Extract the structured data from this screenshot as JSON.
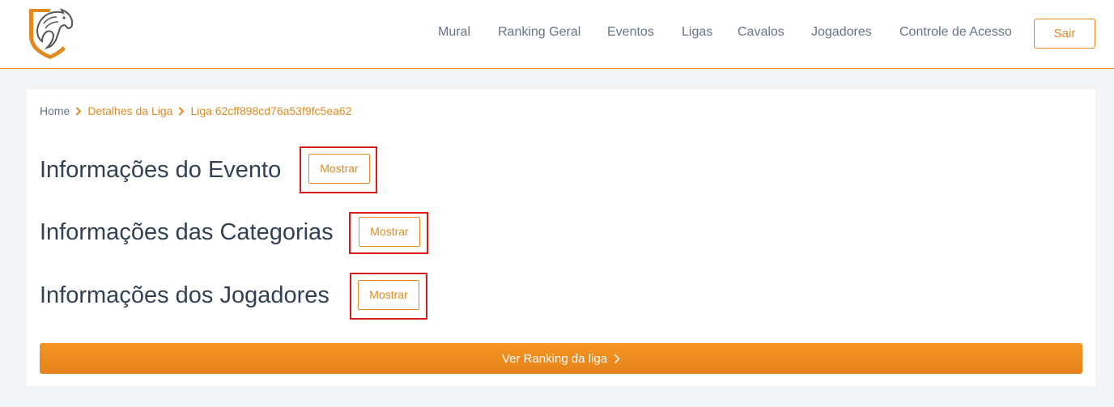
{
  "brand": {
    "logo_icon": "horse-shield-logo",
    "accent_color": "#e08a1f"
  },
  "nav": {
    "items": [
      "Mural",
      "Ranking Geral",
      "Eventos",
      "Ligas",
      "Cavalos",
      "Jogadores",
      "Controle de Acesso"
    ],
    "logout_label": "Sair"
  },
  "breadcrumb": {
    "home": "Home",
    "league_details": "Detalhes da Liga",
    "current": "Liga 62cff898cd76a53f9fc5ea62"
  },
  "sections": [
    {
      "title": "Informações do Evento",
      "button_label": "Mostrar"
    },
    {
      "title": "Informações das Categorias",
      "button_label": "Mostrar"
    },
    {
      "title": "Informações dos Jogadores",
      "button_label": "Mostrar"
    }
  ],
  "ranking_button": {
    "label": "Ver Ranking da liga"
  },
  "highlight_color": "#d81b1b"
}
